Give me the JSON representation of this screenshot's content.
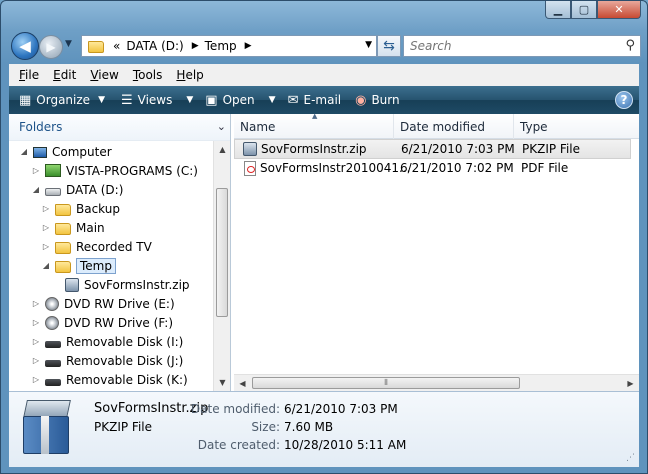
{
  "address": {
    "overflow": "«",
    "crumbs": [
      "DATA (D:)",
      "Temp"
    ]
  },
  "search": {
    "placeholder": "Search"
  },
  "menu": [
    {
      "acc": "F",
      "rest": "ile"
    },
    {
      "acc": "E",
      "rest": "dit"
    },
    {
      "acc": "V",
      "rest": "iew"
    },
    {
      "acc": "T",
      "rest": "ools"
    },
    {
      "acc": "H",
      "rest": "elp"
    }
  ],
  "toolbar": {
    "organize": "Organize",
    "views": "Views",
    "open": "Open",
    "email": "E-mail",
    "burn": "Burn"
  },
  "nav": {
    "header": "Folders",
    "tree": [
      {
        "label": "Computer",
        "icon": "computer-icon",
        "expanded": true
      },
      {
        "label": "VISTA-PROGRAMS (C:)",
        "icon": "drive-icon"
      },
      {
        "label": "DATA (D:)",
        "icon": "drive-icon",
        "expanded": true
      },
      {
        "label": "Backup",
        "icon": "folder-icon"
      },
      {
        "label": "Main",
        "icon": "folder-icon"
      },
      {
        "label": "Recorded TV",
        "icon": "folder-icon"
      },
      {
        "label": "Temp",
        "icon": "folder-icon",
        "expanded": true,
        "selected": true
      },
      {
        "label": "SovFormsInstr.zip",
        "icon": "zip-icon"
      },
      {
        "label": "DVD RW Drive (E:)",
        "icon": "dvd-icon"
      },
      {
        "label": "DVD RW Drive (F:)",
        "icon": "dvd-icon"
      },
      {
        "label": "Removable Disk (I:)",
        "icon": "removable-disk-icon"
      },
      {
        "label": "Removable Disk (J:)",
        "icon": "removable-disk-icon"
      },
      {
        "label": "Removable Disk (K:)",
        "icon": "removable-disk-icon"
      }
    ]
  },
  "files": {
    "columns": [
      "Name",
      "Date modified",
      "Type"
    ],
    "rows": [
      {
        "name": "SovFormsInstr.zip",
        "date": "6/21/2010 7:03 PM",
        "type": "PKZIP File",
        "icon": "zip-icon",
        "selected": true
      },
      {
        "name": "SovFormsInstr2010041...",
        "date": "6/21/2010 7:02 PM",
        "type": "PDF File",
        "icon": "pdf-icon"
      }
    ]
  },
  "details": {
    "name": "SovFormsInstr.zip",
    "type": "PKZIP File",
    "modified_label": "Date modified:",
    "modified": "6/21/2010 7:03 PM",
    "size_label": "Size:",
    "size": "7.60 MB",
    "created_label": "Date created:",
    "created": "10/28/2010 5:11 AM"
  }
}
